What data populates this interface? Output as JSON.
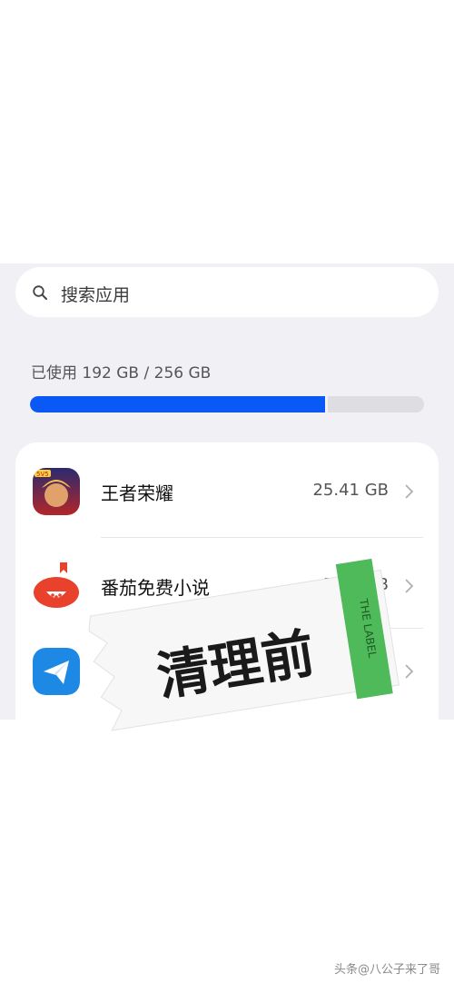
{
  "search": {
    "placeholder": "搜索应用",
    "icon": "search-icon"
  },
  "storage": {
    "usage_text": "已使用 192 GB / 256 GB",
    "used_gb": 192,
    "total_gb": 256,
    "used_fraction": 0.75,
    "bar_color": "#0a59f7"
  },
  "apps": [
    {
      "name": "王者荣耀",
      "size": "25.41 GB",
      "icon": "honor-of-kings-icon"
    },
    {
      "name": "番茄免费小说",
      "size": "5.55 GB",
      "icon": "tomato-novel-icon"
    },
    {
      "name": "",
      "size": "",
      "icon": "paper-plane-app-icon"
    }
  ],
  "overlay_label": {
    "title": "清理前",
    "tag": "THE LABEL"
  },
  "watermark": "头条@八公子来了哥"
}
